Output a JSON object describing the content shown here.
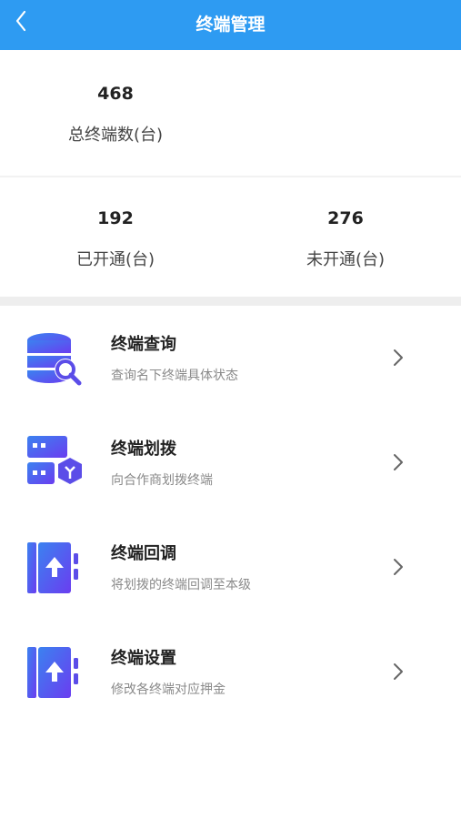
{
  "header": {
    "title": "终端管理",
    "back_icon": "chevron-left-icon",
    "color": "#2e9bf2"
  },
  "stats": {
    "total": {
      "value": "468",
      "label": "总终端数(台)"
    },
    "opened": {
      "value": "192",
      "label": "已开通(台)"
    },
    "unopened": {
      "value": "276",
      "label": "未开通(台)"
    }
  },
  "menu": {
    "items": [
      {
        "title": "终端查询",
        "subtitle": "查询名下终端具体状态",
        "icon": "database-search-icon"
      },
      {
        "title": "终端划拨",
        "subtitle": "向合作商划拨终端",
        "icon": "transfer-boxes-icon"
      },
      {
        "title": "终端回调",
        "subtitle": "将划拨的终端回调至本级",
        "icon": "upload-door-icon"
      },
      {
        "title": "终端设置",
        "subtitle": "修改各终端对应押金",
        "icon": "upload-door-icon"
      }
    ]
  },
  "colors": {
    "accent_purple": "#5b4de8",
    "accent_blue": "#3a7df0"
  }
}
